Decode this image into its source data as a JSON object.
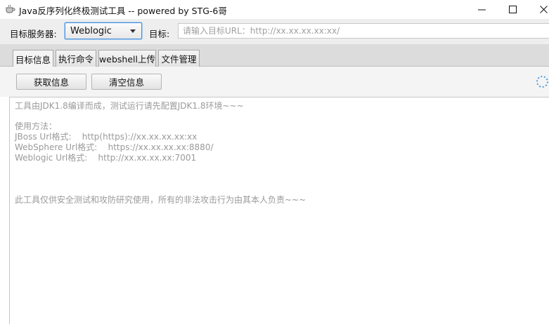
{
  "window": {
    "title": "Java反序列化终极测试工具  -- powered by STG-6哥",
    "icon": "java-cup-icon",
    "controls": {
      "minimize": "minimize-icon",
      "maximize": "maximize-icon",
      "close": "close-icon"
    }
  },
  "toolbar": {
    "server_label": "目标服务器:",
    "server_selected": "Weblogic",
    "target_label": "目标:",
    "target_value": "",
    "target_placeholder": "请输入目标URL：http://xx.xx.xx.xx:xx/"
  },
  "tabs": [
    {
      "label": "目标信息",
      "active": true
    },
    {
      "label": "执行命令",
      "active": false
    },
    {
      "label": "webshell上传",
      "active": false
    },
    {
      "label": "文件管理",
      "active": false
    }
  ],
  "actions": {
    "get_info_label": "获取信息",
    "clear_info_label": "清空信息",
    "spinner_icon": "loading-spinner-icon"
  },
  "output": {
    "lines": [
      "工具由JDK1.8编译而成，测试运行请先配置JDK1.8环境~~~",
      "",
      "使用方法：",
      "JBoss Url格式:    http(https)://xx.xx.xx.xx:xx",
      "WebSphere Url格式:    https://xx.xx.xx.xx:8880/",
      "Weblogic Url格式:    http://xx.xx.xx.xx:7001",
      "",
      "",
      "",
      "此工具仅供安全测试和攻防研究使用，所有的非法攻击行为由其本人负责~~~"
    ]
  },
  "colors": {
    "accent_border": "#4a90d9",
    "toolbar_bg": "#eeeeee",
    "tabbar_bg": "#dcdcdc",
    "output_text": "#9a9a9a"
  }
}
